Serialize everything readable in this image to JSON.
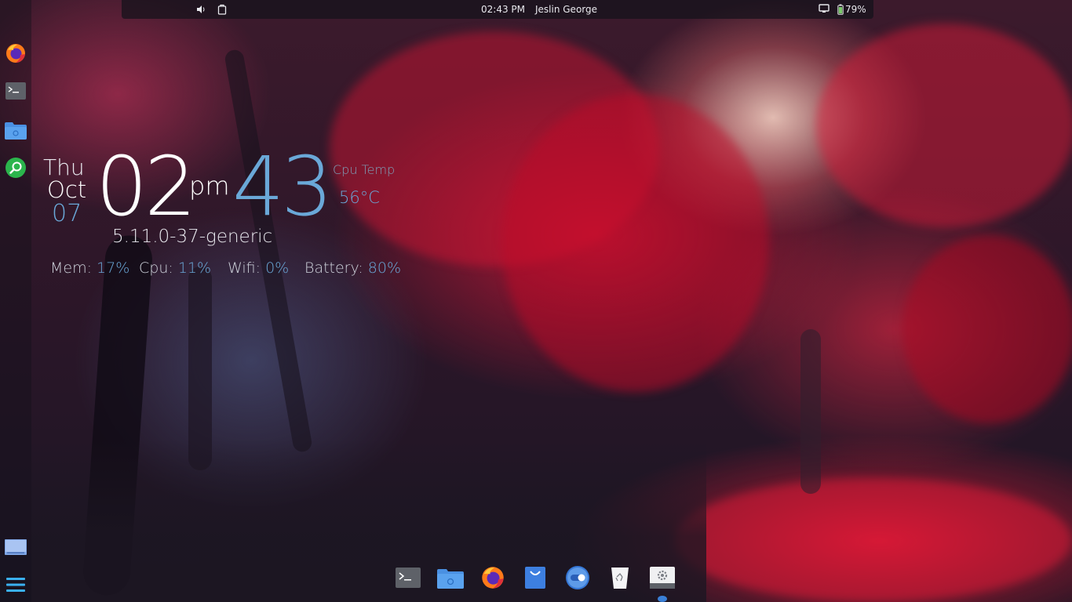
{
  "top_bar": {
    "time": "02:43 PM",
    "user": "Jeslin George",
    "battery_percent": "79%",
    "icons": [
      "volume-icon",
      "tray-app-icon",
      "display-icon",
      "battery-icon"
    ]
  },
  "left_dock": {
    "items": [
      {
        "name": "firefox",
        "icon": "firefox-icon"
      },
      {
        "name": "terminal",
        "icon": "terminal-icon"
      },
      {
        "name": "files",
        "icon": "folder-icon"
      },
      {
        "name": "search",
        "icon": "search-icon"
      },
      {
        "name": "workspace",
        "icon": "workspace-icon"
      },
      {
        "name": "menu",
        "icon": "hamburger-menu-icon"
      }
    ]
  },
  "conky": {
    "day": "Thu",
    "month": "Oct",
    "date": "07",
    "hour": "02",
    "ampm": "pm",
    "minute": "43",
    "cpu_temp_label": "Cpu Temp",
    "cpu_temp_value": "56°C",
    "kernel": "5.11.0-37-generic",
    "mem_label": "Mem:",
    "mem_value": "17%",
    "cpu_label": "Cpu:",
    "cpu_value": "11%",
    "wifi_label": "Wifi:",
    "wifi_value": "0%",
    "battery_label": "Battery:",
    "battery_value": "80%"
  },
  "bottom_dock": {
    "items": [
      {
        "name": "terminal",
        "icon": "terminal-icon"
      },
      {
        "name": "files",
        "icon": "folder-icon"
      },
      {
        "name": "firefox",
        "icon": "firefox-icon"
      },
      {
        "name": "software-store",
        "icon": "shopping-bag-icon"
      },
      {
        "name": "toggle-app",
        "icon": "toggle-icon"
      },
      {
        "name": "trash",
        "icon": "trash-icon"
      },
      {
        "name": "settings",
        "icon": "settings-icon"
      }
    ]
  },
  "colors": {
    "accent_blue": "#6aa8d8",
    "panel_bg": "#14121a",
    "text_white": "#ffffff"
  }
}
